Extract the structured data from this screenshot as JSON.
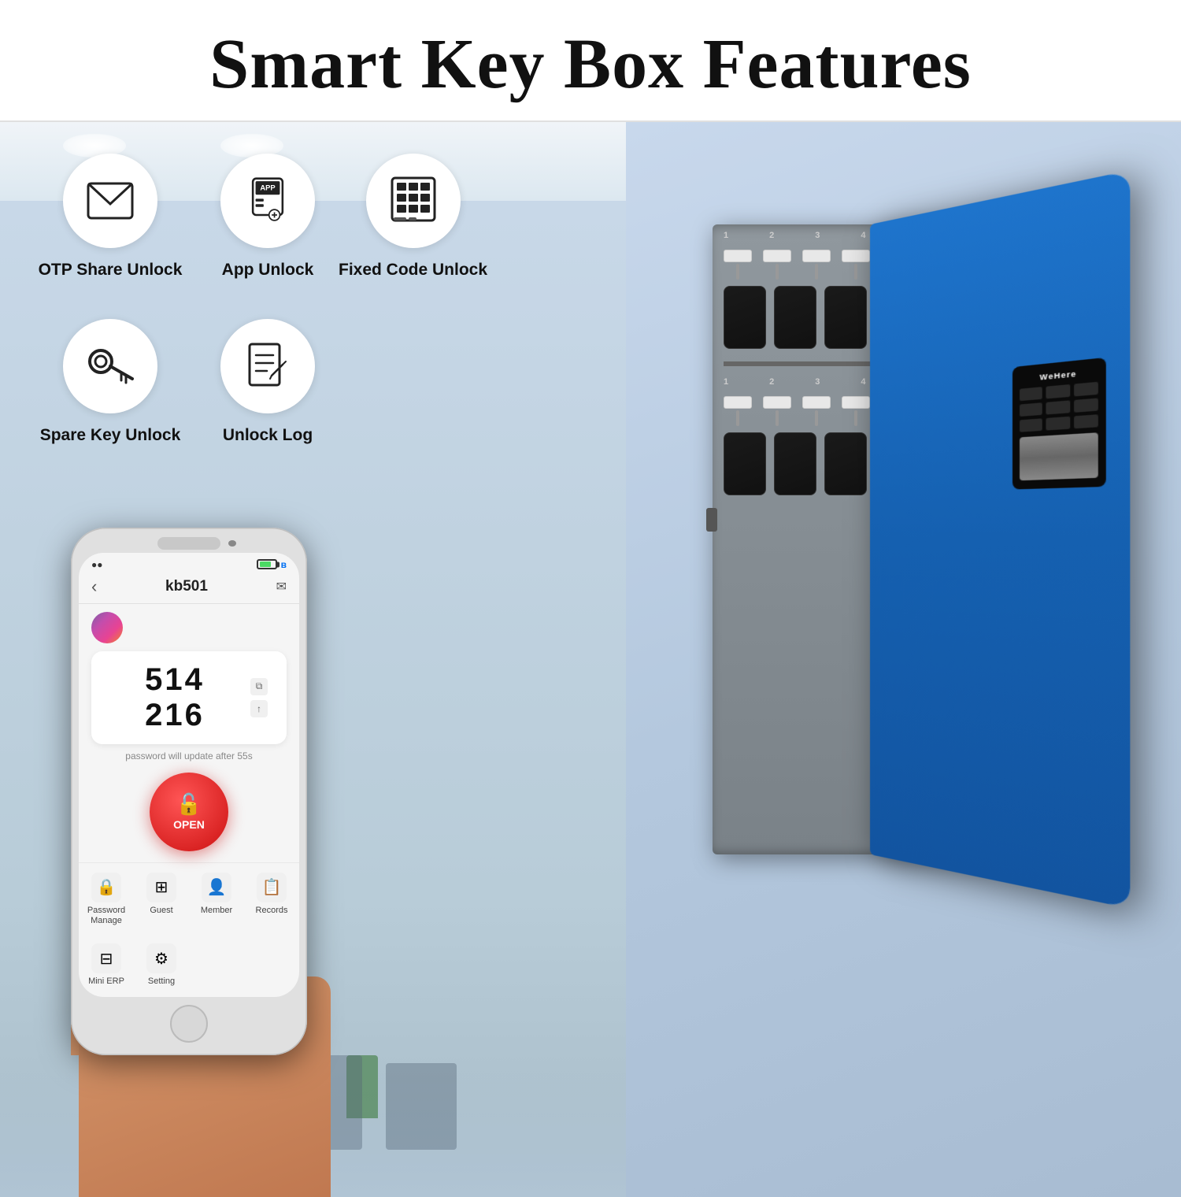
{
  "header": {
    "title": "Smart Key Box Features"
  },
  "features": [
    {
      "id": "otp-share",
      "label": "OTP Share Unlock",
      "icon": "email"
    },
    {
      "id": "app-unlock",
      "label": "App Unlock",
      "icon": "app"
    },
    {
      "id": "spare-key",
      "label": "Spare Key Unlock",
      "icon": "key"
    },
    {
      "id": "unlock-log",
      "label": "Unlock Log",
      "icon": "document"
    }
  ],
  "fixed_code": {
    "label": "Fixed Code Unlock",
    "icon": "keypad"
  },
  "phone": {
    "device_name": "kb501",
    "otp_code": "514 216",
    "otp_update_text": "password will update after 55s",
    "open_label": "OPEN",
    "menu_items": [
      {
        "label": "Password\nManage",
        "icon": "lock"
      },
      {
        "label": "Guest",
        "icon": "grid"
      },
      {
        "label": "Member",
        "icon": "person"
      },
      {
        "label": "Records",
        "icon": "list"
      }
    ],
    "menu_row2": [
      {
        "label": "Mini ERP",
        "icon": "grid2"
      },
      {
        "label": "Setting",
        "icon": "gear"
      }
    ]
  },
  "keypad": {
    "brand": "WeHere"
  },
  "colors": {
    "accent_blue": "#1a6bbf",
    "open_red": "#cc2222",
    "background_left": "#c8d8e8",
    "background_right": "#c0d4e8"
  }
}
